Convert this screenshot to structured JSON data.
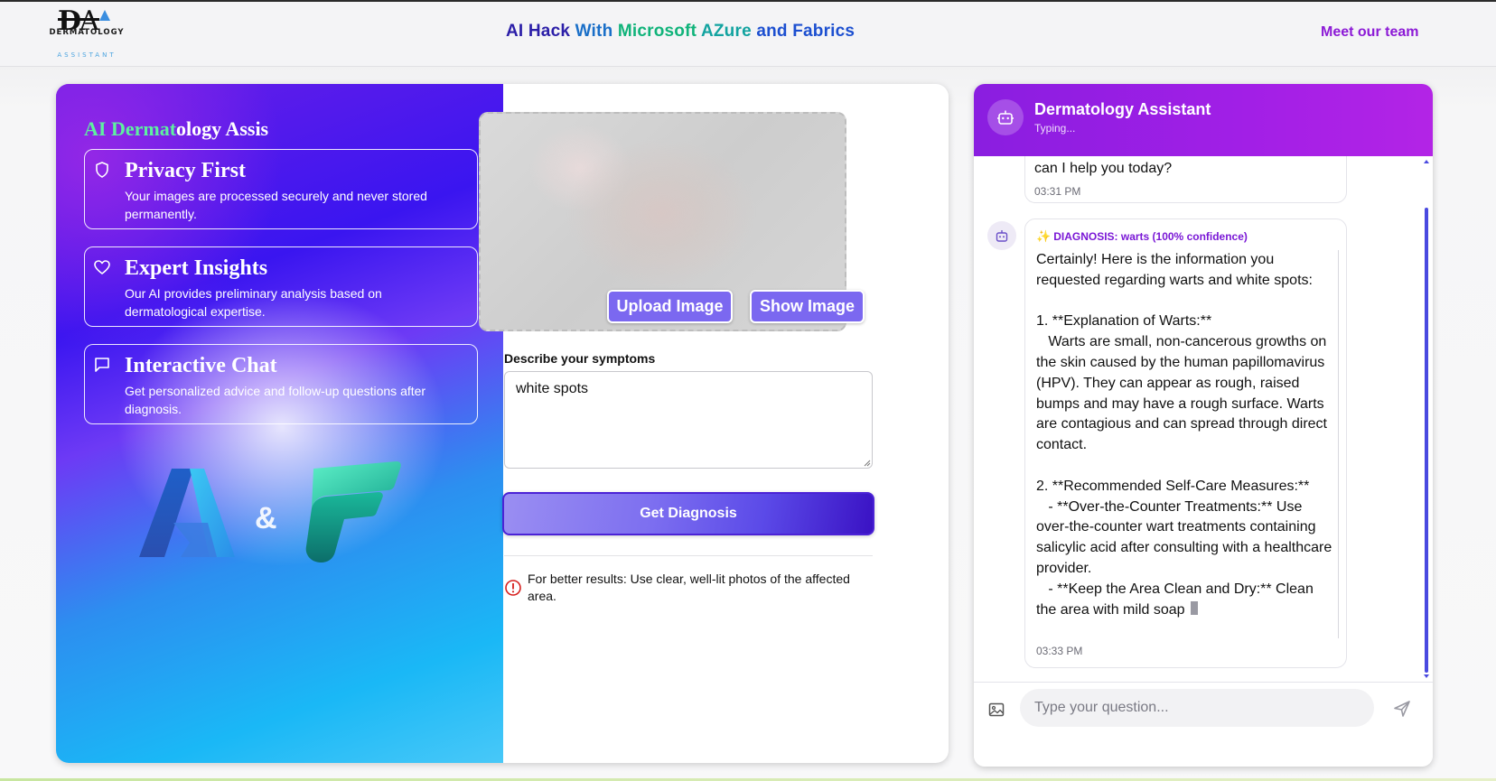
{
  "header": {
    "logo_top": "DERMATOLOGY",
    "logo_bottom": "ASSISTANT",
    "title_parts": [
      "AI Hack",
      "With",
      "Microsoft",
      "AZure",
      "and Fabrics"
    ],
    "team_link": "Meet our team"
  },
  "hero": {
    "title_a": "AI Dermat",
    "title_b": "ology Assis",
    "features": [
      {
        "icon": "shield-icon",
        "title": "Privacy First",
        "desc": "Your images are processed securely and never stored permanently."
      },
      {
        "icon": "heart-icon",
        "title": "Expert Insights",
        "desc": "Our AI provides preliminary analysis based on dermatological expertise."
      },
      {
        "icon": "chat-bubble-icon",
        "title": "Interactive Chat",
        "desc": "Get personalized advice and follow-up questions after diagnosis."
      }
    ],
    "amp": "&"
  },
  "form": {
    "upload_label": "Upload Image",
    "show_label": "Show Image",
    "symptom_label": "Describe your symptoms",
    "symptom_value": "white spots",
    "diagnose_label": "Get Diagnosis",
    "tip": "For better results: Use clear, well-lit photos of the affected area."
  },
  "chat": {
    "name": "Dermatology Assistant",
    "status": "Typing...",
    "msg1_text": "can I help you today?",
    "msg1_time": "03:31 PM",
    "diagnosis": "DIAGNOSIS: warts (100% confidence)",
    "msg2_body": "Certainly! Here is the information you requested regarding warts and white spots:\n\n1. **Explanation of Warts:**\n   Warts are small, non-cancerous growths on the skin caused by the human papillomavirus (HPV). They can appear as rough, raised bumps and may have a rough surface. Warts are contagious and can spread through direct contact.\n\n2. **Recommended Self-Care Measures:**\n   - **Over-the-Counter Treatments:** Use over-the-counter wart treatments containing salicylic acid after consulting with a healthcare provider.\n   - **Keep the Area Clean and Dry:** Clean the area with mild soap",
    "msg2_time": "03:33 PM",
    "input_placeholder": "Type your question..."
  },
  "colors": {
    "accent_purple": "#8c1ad6",
    "button_violet": "#7b68f0",
    "chat_header": "#a21fe6"
  }
}
